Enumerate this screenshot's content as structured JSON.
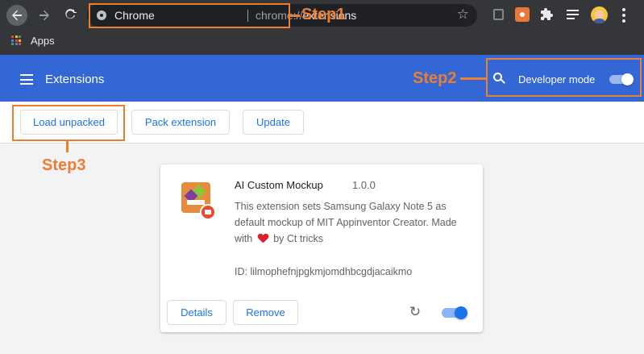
{
  "browser": {
    "omnibox_label": "Chrome",
    "url_scheme": "chrome://",
    "url_host": "extensions",
    "bookmarks": [
      {
        "label": "Apps"
      }
    ]
  },
  "extensions_page": {
    "title": "Extensions",
    "developer_mode_label": "Developer mode",
    "developer_mode_on": true,
    "actions": {
      "load_unpacked": "Load unpacked",
      "pack_extension": "Pack extension",
      "update": "Update"
    }
  },
  "extension_card": {
    "name": "AI Custom Mockup",
    "version": "1.0.0",
    "description_before_heart": "This extension sets Samsung Galaxy Note 5 as default mockup of MIT Appinventor Creator. Made with",
    "description_after_heart": "by Ct tricks",
    "id_text": "ID: lilmophefnjpgkmjomdhbcgdjacaikmo",
    "details_label": "Details",
    "remove_label": "Remove",
    "enabled": true
  },
  "annotations": {
    "step1": "Step1",
    "step2": "Step2",
    "step3": "Step3",
    "color": "#ed7d31"
  },
  "colors": {
    "header_blue": "#3367d6",
    "link_blue": "#1a73e8",
    "chrome_dark": "#35363a"
  }
}
